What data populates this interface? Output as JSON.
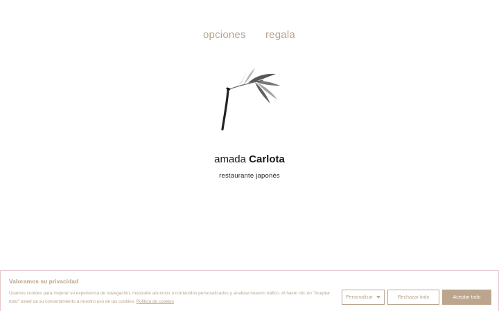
{
  "nav": {
    "items": [
      {
        "label": "opciones"
      },
      {
        "label": "regala"
      }
    ]
  },
  "brand": {
    "name_light": "amada",
    "name_bold": "Carlota",
    "tagline": "restaurante japonés",
    "logo_icon": "bamboo-icon"
  },
  "cookie": {
    "title": "Valoramos su privacidad",
    "text": "Usamos cookies para mejorar su experiencia de navegación, mostrarle anuncios o contenidos personalizados y analizar nuestro tráfico. Al hacer clic en \"Aceptar todo\" usted da su consentimiento a nuestro uso de las cookies.",
    "policy_link": "Política de cookies",
    "buttons": {
      "customize": "Personalizar",
      "reject": "Rechazar todo",
      "accept": "Aceptar todo"
    }
  },
  "colors": {
    "accent": "#b8a48c",
    "accent_button": "#bca58d",
    "banner_border": "#e6c9cc",
    "text_dark": "#1a1a1a"
  }
}
